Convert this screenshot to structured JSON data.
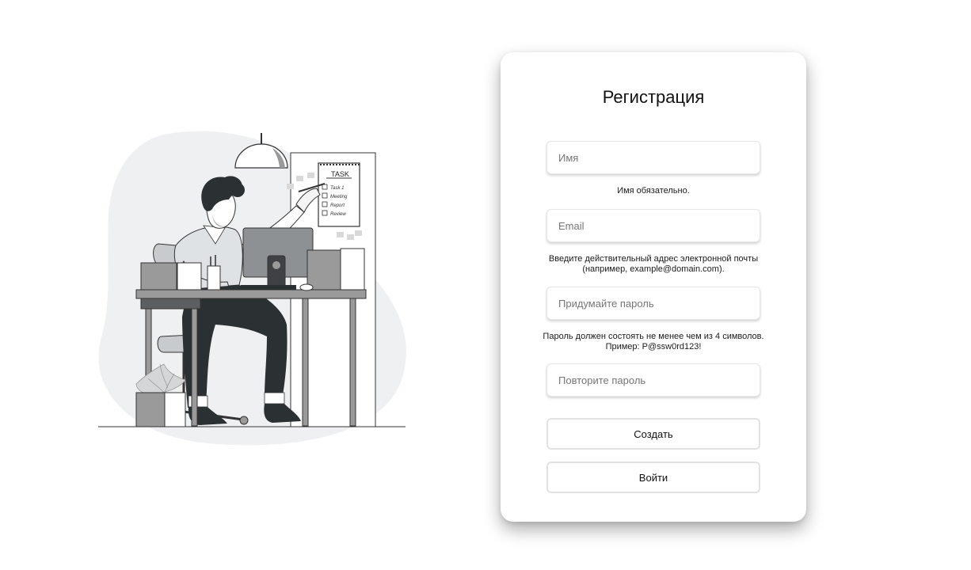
{
  "illustration": {
    "calendar_title": "TASK",
    "calendar_items": [
      "Task 1",
      "Meeting",
      "Report",
      "Review"
    ]
  },
  "form": {
    "title": "Регистрация",
    "name": {
      "placeholder": "Имя",
      "value": ""
    },
    "name_hint": "Имя обязательно.",
    "email": {
      "placeholder": "Email",
      "value": ""
    },
    "email_hint": "Введите действительный адрес электронной почты (например, example@domain.com).",
    "password": {
      "placeholder": "Придумайте пароль",
      "value": ""
    },
    "password_hint": "Пароль должен состоять не менее чем из 4 символов. Пример: P@ssw0rd123!",
    "confirm": {
      "placeholder": "Повторите пароль",
      "value": ""
    },
    "create_label": "Создать",
    "login_label": "Войти"
  }
}
